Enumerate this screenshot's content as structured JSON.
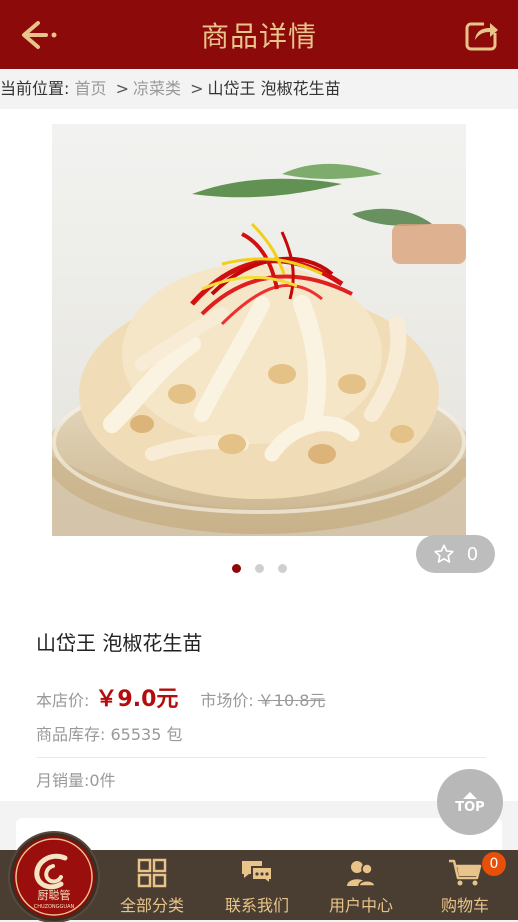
{
  "header": {
    "title": "商品详情"
  },
  "breadcrumb": {
    "prefix": "当前位置:",
    "home": "首页",
    "category": "凉菜类",
    "current": "山岱王 泡椒花生苗",
    "sep": ">"
  },
  "gallery": {
    "favorite_count": "0",
    "dots": 3,
    "active_dot": 0
  },
  "product": {
    "name": "山岱王 泡椒花生苗",
    "store_price_label": "本店价:",
    "store_price": "￥9.0元",
    "market_price_label": "市场价:",
    "market_price": "￥10.8元",
    "stock_label": "商品库存:",
    "stock_value": "65535 包",
    "sales_label": "月销量:",
    "sales_value": "0件"
  },
  "top_button": {
    "label": "TOP"
  },
  "logo": {
    "text": "厨聪管",
    "subtext": "CHUZONGGUAN"
  },
  "nav": {
    "categories": "全部分类",
    "contact": "联系我们",
    "user_center": "用户中心",
    "cart": "购物车",
    "cart_count": "0"
  },
  "colors": {
    "brand_red": "#8c0a0a",
    "gold": "#e8c48a",
    "price_red": "#b40c0c",
    "nav_bg": "#4a3d32"
  }
}
